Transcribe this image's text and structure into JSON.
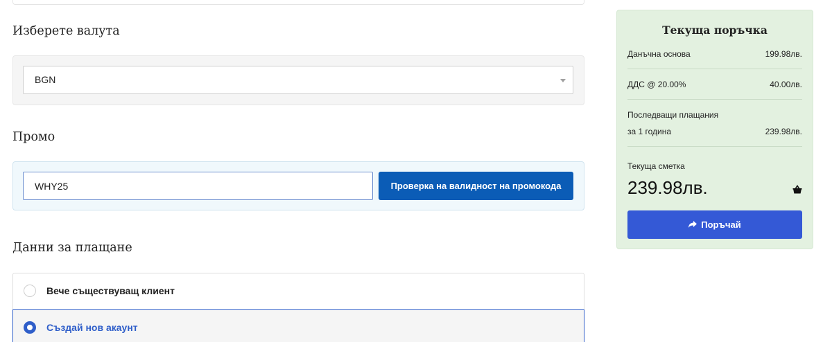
{
  "currency": {
    "heading": "Изберете валута",
    "selected": "BGN"
  },
  "promo": {
    "heading": "Промо",
    "code": "WHY25",
    "button_label": "Проверка на валидност на промокода"
  },
  "payment": {
    "heading": "Данни за плащане",
    "options": [
      {
        "label": "Вече съществуващ клиент",
        "selected": false
      },
      {
        "label": "Създай нов акаунт",
        "selected": true
      }
    ]
  },
  "order_summary": {
    "title": "Текуща поръчка",
    "rows": [
      {
        "label": "Данъчна основа",
        "value": "199.98лв."
      },
      {
        "label": "ДДС @ 20.00%",
        "value": "40.00лв."
      }
    ],
    "recurring": {
      "label": "Последващи плащания",
      "period": "за 1 година",
      "value": "239.98лв."
    },
    "total_label": "Текуща сметка",
    "total": "239.98лв.",
    "order_button": "Поръчай"
  },
  "icons": {
    "select_caret": "chevron-down-icon",
    "total": "basket-icon",
    "order_button": "share-arrow-icon",
    "radio_unchecked": "radio-unchecked-icon",
    "radio_checked": "radio-checked-icon"
  },
  "colors": {
    "promo_button": "#0b5cb6",
    "order_button": "#3459d6",
    "selected_accent": "#2f5ec9",
    "summary_background": "#e3f1e0"
  }
}
